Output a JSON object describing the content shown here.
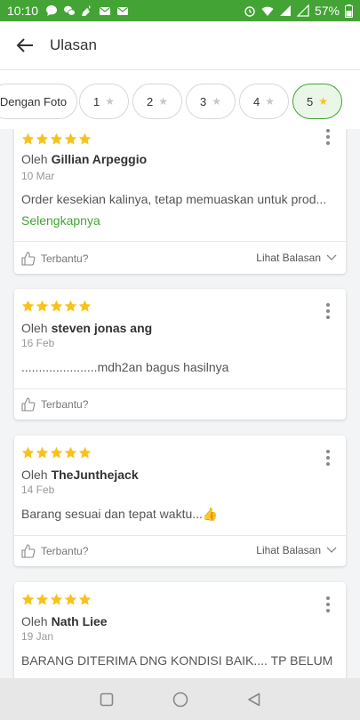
{
  "status": {
    "time": "10:10",
    "battery": "57%"
  },
  "header": {
    "title": "Ulasan"
  },
  "filters": [
    {
      "label": "Dengan Foto",
      "star": false
    },
    {
      "label": "1",
      "star": true
    },
    {
      "label": "2",
      "star": true
    },
    {
      "label": "3",
      "star": true
    },
    {
      "label": "4",
      "star": true
    },
    {
      "label": "5",
      "star": true
    }
  ],
  "reviews": [
    {
      "by_prefix": "Oleh",
      "author": "Gillian Arpeggio",
      "date": "10 Mar",
      "text": "Order kesekian kalinya, tetap memuaskan untuk prod...",
      "more": "Selengkapnya",
      "helpful": "Terbantu?",
      "replies": "Lihat Balasan"
    },
    {
      "by_prefix": "Oleh",
      "author": "steven jonas ang",
      "date": "16 Feb",
      "text": "......................mdh2an bagus hasilnya",
      "helpful": "Terbantu?"
    },
    {
      "by_prefix": "Oleh",
      "author": "TheJunthejack",
      "date": "14 Feb",
      "text": "Barang sesuai dan tepat waktu...👍",
      "helpful": "Terbantu?",
      "replies": "Lihat Balasan"
    },
    {
      "by_prefix": "Oleh",
      "author": "Nath Liee",
      "date": "19 Jan",
      "text": "BARANG DITERIMA DNG KONDISI BAIK.... TP BELUM"
    }
  ]
}
